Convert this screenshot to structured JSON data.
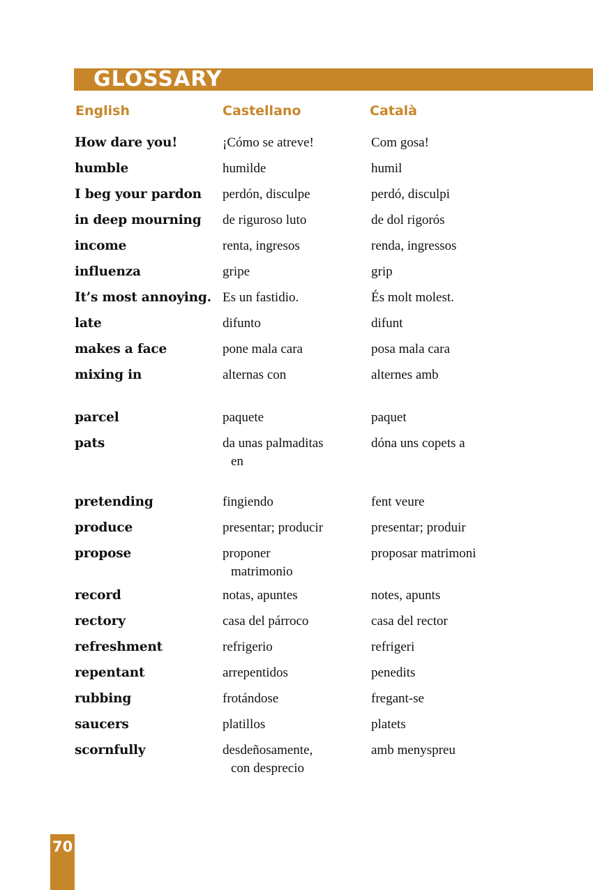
{
  "title": "GLOSSARY",
  "columns": {
    "english": "English",
    "castellano": "Castellano",
    "catala": "Català"
  },
  "entries": [
    {
      "en": "How dare you!",
      "es": "¡Cómo se atreve!",
      "ca": "Com gosa!"
    },
    {
      "en": "humble",
      "es": "humilde",
      "ca": "humil"
    },
    {
      "en": "I beg your pardon",
      "es": "perdón, disculpe",
      "ca": "perdó, disculpi"
    },
    {
      "en": "in deep mourning",
      "es": "de riguroso luto",
      "ca": "de dol rigorós"
    },
    {
      "en": "income",
      "es": "renta, ingresos",
      "ca": "renda, ingressos"
    },
    {
      "en": "influenza",
      "es": "gripe",
      "ca": "grip"
    },
    {
      "en": "It’s most annoying.",
      "es": "Es un fastidio.",
      "ca": "És molt molest."
    },
    {
      "en": "late",
      "es": "difunto",
      "ca": "difunt"
    },
    {
      "en": "makes a face",
      "es": "pone mala cara",
      "ca": "posa mala cara"
    },
    {
      "en": "mixing in",
      "es": "alternas con",
      "ca": "alternes amb"
    },
    {
      "en": "parcel",
      "es": "paquete",
      "ca": "paquet"
    },
    {
      "en": "pats",
      "es": "da unas palmaditas",
      "es_cont": "en",
      "ca": "dóna uns copets a"
    },
    {
      "en": "pretending",
      "es": "fingiendo",
      "ca": "fent veure"
    },
    {
      "en": "produce",
      "es": "presentar; producir",
      "ca": "presentar; produir"
    },
    {
      "en": "propose",
      "es": "proponer",
      "es_cont": "matrimonio",
      "ca": "proposar matrimoni"
    },
    {
      "en": "record",
      "es": "notas, apuntes",
      "ca": "notes, apunts"
    },
    {
      "en": "rectory",
      "es": "casa del párroco",
      "ca": "casa del rector"
    },
    {
      "en": "refreshment",
      "es": "refrigerio",
      "ca": "refrigeri"
    },
    {
      "en": "repentant",
      "es": "arrepentidos",
      "ca": "penedits"
    },
    {
      "en": "rubbing",
      "es": "frotándose",
      "ca": "fregant-se"
    },
    {
      "en": "saucers",
      "es": "platillos",
      "ca": "platets"
    },
    {
      "en": "scornfully",
      "es": "desdeñosamente,",
      "es_cont": "con desprecio",
      "ca": "amb menyspreu"
    }
  ],
  "page_number": "70"
}
